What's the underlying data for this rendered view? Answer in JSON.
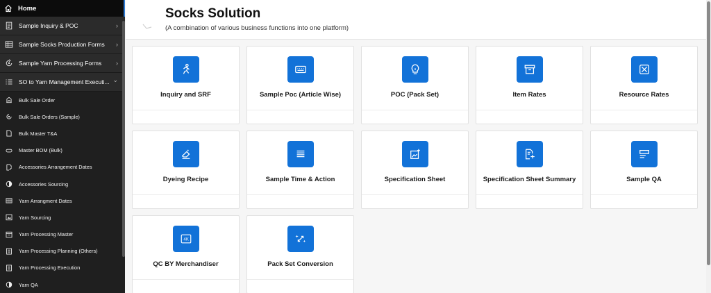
{
  "sidebar": {
    "home_label": "Home",
    "main_items": [
      {
        "label": "Sample Inquiry & POC",
        "icon": "document-icon",
        "chevron": "›"
      },
      {
        "label": "Sample Socks Production Forms",
        "icon": "table-icon",
        "chevron": "›"
      },
      {
        "label": "Sample Yarn Processing Forms",
        "icon": "cycle-icon",
        "chevron": "›"
      },
      {
        "label": "SO to Yarn Management Executi...",
        "icon": "list-icon",
        "chevron": "⌄"
      }
    ],
    "sub_items": [
      {
        "label": "Bulk Sale Order",
        "icon": "building-icon"
      },
      {
        "label": "Bulk Sale Orders (Sample)",
        "icon": "cycle-icon"
      },
      {
        "label": "Bulk Master T&A",
        "icon": "file-icon"
      },
      {
        "label": "Master BOM (Bulk)",
        "icon": "pill-icon"
      },
      {
        "label": "Accessories Arrangement Dates",
        "icon": "file-edit-icon"
      },
      {
        "label": "Accessories Sourcing",
        "icon": "half-circle-icon"
      },
      {
        "label": "Yarn Arrangment Dates",
        "icon": "table-icon"
      },
      {
        "label": "Yarn Sourcing",
        "icon": "image-box-icon"
      },
      {
        "label": "Yarn Processing Master",
        "icon": "window-icon"
      },
      {
        "label": "Yarn Processing Planning (Others)",
        "icon": "doc-box-icon"
      },
      {
        "label": "Yarn Processing Execution",
        "icon": "doc-box-icon"
      },
      {
        "label": "Yarn QA",
        "icon": "half-circle-icon"
      }
    ]
  },
  "header": {
    "title": "Socks Solution",
    "subtitle": "(A combination of various business functions into one platform)"
  },
  "tiles": [
    {
      "label": "Inquiry and SRF",
      "icon": "running-person-icon"
    },
    {
      "label": "Sample Poc (Article Wise)",
      "icon": "keyboard-icon"
    },
    {
      "label": "POC (Pack Set)",
      "icon": "lightbulb-icon"
    },
    {
      "label": "Item Rates",
      "icon": "archive-box-icon"
    },
    {
      "label": "Resource Rates",
      "icon": "grid-x-icon"
    },
    {
      "label": "Dyeing Recipe",
      "icon": "eraser-icon"
    },
    {
      "label": "Sample Time & Action",
      "icon": "lines-icon"
    },
    {
      "label": "Specification Sheet",
      "icon": "image-sparkle-icon"
    },
    {
      "label": "Specification Sheet Summary",
      "icon": "document-sparkle-icon"
    },
    {
      "label": "Sample QA",
      "icon": "form-icon"
    },
    {
      "label": "QC BY Merchandiser",
      "icon": "4k-icon",
      "icon_text": "4K"
    },
    {
      "label": "Pack Set Conversion",
      "icon": "sparkles-icon"
    }
  ],
  "colors": {
    "sidebar_bg": "#1f1f1f",
    "accent": "#1272d8",
    "page_bg": "#f6f6f6"
  }
}
